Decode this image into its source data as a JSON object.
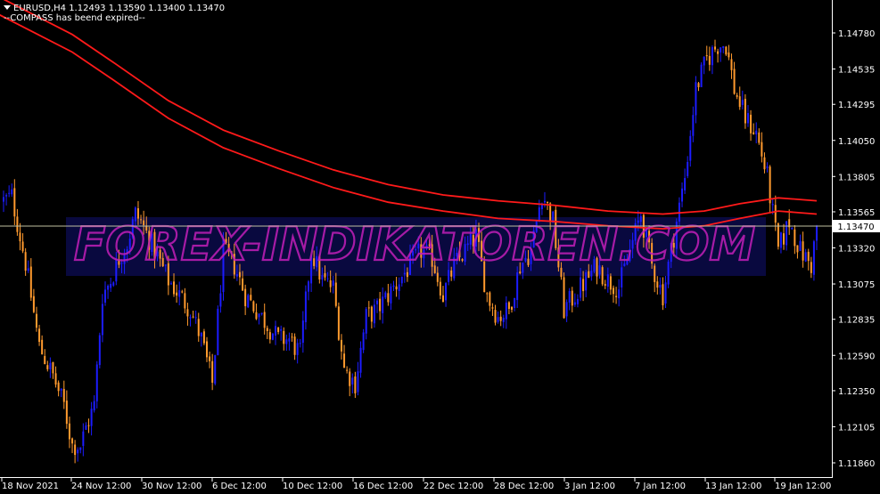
{
  "header": {
    "symbol_line": "EURUSD,H4  1.12493 1.13590 1.13400 1.13470",
    "status_line": "--COMPASS has beend expired--"
  },
  "watermark": "FOREX-INDIKATOREN.COM",
  "price_label": "1.13470",
  "colors": {
    "background": "#000000",
    "bull": "#1c1cff",
    "bear": "#ff9a2e",
    "ma": "#ff1a1a",
    "grid_text": "#ffffff",
    "price_line": "#c0c0a0"
  },
  "chart_data": {
    "type": "candlestick",
    "symbol": "EURUSD",
    "timeframe": "H4",
    "ylim": [
      1.1174,
      1.149
    ],
    "yticks": [
      "1.14780",
      "1.14535",
      "1.14295",
      "1.14050",
      "1.13805",
      "1.13565",
      "1.13320",
      "1.13075",
      "1.12835",
      "1.12590",
      "1.12350",
      "1.12105",
      "1.11860"
    ],
    "xticks": [
      "18 Nov 2021",
      "24 Nov 12:00",
      "30 Nov 12:00",
      "6 Dec 12:00",
      "10 Dec 12:00",
      "16 Dec 12:00",
      "22 Dec 12:00",
      "28 Dec 12:00",
      "3 Jan 12:00",
      "7 Jan 12:00",
      "13 Jan 12:00",
      "19 Jan 12:00"
    ],
    "last_price": 1.1347,
    "close_path": [
      [
        0,
        1.1364
      ],
      [
        3,
        1.1367
      ],
      [
        8,
        1.1322
      ],
      [
        13,
        1.1265
      ],
      [
        18,
        1.1245
      ],
      [
        22,
        1.1225
      ],
      [
        25,
        1.1198
      ],
      [
        28,
        1.1198
      ],
      [
        30,
        1.121
      ],
      [
        33,
        1.1225
      ],
      [
        36,
        1.13
      ],
      [
        39,
        1.131
      ],
      [
        42,
        1.1325
      ],
      [
        45,
        1.1335
      ],
      [
        48,
        1.1355
      ],
      [
        50,
        1.135
      ],
      [
        55,
        1.133
      ],
      [
        60,
        1.131
      ],
      [
        64,
        1.13
      ],
      [
        68,
        1.129
      ],
      [
        72,
        1.127
      ],
      [
        76,
        1.124
      ],
      [
        80,
        1.133
      ],
      [
        84,
        1.132
      ],
      [
        88,
        1.13
      ],
      [
        92,
        1.129
      ],
      [
        96,
        1.128
      ],
      [
        100,
        1.127
      ],
      [
        104,
        1.127
      ],
      [
        108,
        1.126
      ],
      [
        112,
        1.133
      ],
      [
        116,
        1.131
      ],
      [
        120,
        1.1305
      ],
      [
        124,
        1.125
      ],
      [
        128,
        1.124
      ],
      [
        132,
        1.1285
      ],
      [
        136,
        1.129
      ],
      [
        140,
        1.13
      ],
      [
        144,
        1.131
      ],
      [
        148,
        1.132
      ],
      [
        152,
        1.133
      ],
      [
        156,
        1.1325
      ],
      [
        160,
        1.13
      ],
      [
        164,
        1.132
      ],
      [
        168,
        1.133
      ],
      [
        172,
        1.134
      ],
      [
        176,
        1.13
      ],
      [
        180,
        1.1285
      ],
      [
        184,
        1.129
      ],
      [
        188,
        1.132
      ],
      [
        192,
        1.133
      ],
      [
        196,
        1.137
      ],
      [
        200,
        1.135
      ],
      [
        204,
        1.129
      ],
      [
        208,
        1.13
      ],
      [
        212,
        1.131
      ],
      [
        216,
        1.132
      ],
      [
        220,
        1.131
      ],
      [
        224,
        1.1305
      ],
      [
        228,
        1.133
      ],
      [
        232,
        1.1355
      ],
      [
        236,
        1.132
      ],
      [
        240,
        1.13
      ],
      [
        244,
        1.134
      ],
      [
        248,
        1.138
      ],
      [
        252,
        1.144
      ],
      [
        256,
        1.146
      ],
      [
        260,
        1.147
      ],
      [
        263,
        1.147
      ],
      [
        266,
        1.144
      ],
      [
        270,
        1.142
      ],
      [
        274,
        1.141
      ],
      [
        278,
        1.138
      ],
      [
        282,
        1.133
      ],
      [
        286,
        1.135
      ],
      [
        290,
        1.133
      ],
      [
        294,
        1.132
      ],
      [
        296,
        1.1347
      ]
    ],
    "series": [
      {
        "name": "",
        "type": "moving-average",
        "values": [
          [
            -20,
            1.152
          ],
          [
            25,
            1.1477
          ],
          [
            40,
            1.1458
          ],
          [
            60,
            1.1432
          ],
          [
            80,
            1.1412
          ],
          [
            100,
            1.1398
          ],
          [
            120,
            1.1385
          ],
          [
            140,
            1.1375
          ],
          [
            160,
            1.1368
          ],
          [
            180,
            1.1364
          ],
          [
            200,
            1.1361
          ],
          [
            220,
            1.1357
          ],
          [
            240,
            1.1355
          ],
          [
            255,
            1.1357
          ],
          [
            268,
            1.1362
          ],
          [
            282,
            1.1366
          ],
          [
            296,
            1.1364
          ]
        ]
      },
      {
        "name": "",
        "type": "moving-average",
        "values": [
          [
            -20,
            1.1508
          ],
          [
            25,
            1.1465
          ],
          [
            40,
            1.1446
          ],
          [
            60,
            1.142
          ],
          [
            80,
            1.14
          ],
          [
            100,
            1.1386
          ],
          [
            120,
            1.1373
          ],
          [
            140,
            1.1363
          ],
          [
            160,
            1.1357
          ],
          [
            180,
            1.1352
          ],
          [
            200,
            1.135
          ],
          [
            220,
            1.1347
          ],
          [
            240,
            1.1345
          ],
          [
            255,
            1.1347
          ],
          [
            268,
            1.1352
          ],
          [
            282,
            1.1357
          ],
          [
            296,
            1.1355
          ]
        ]
      }
    ]
  }
}
